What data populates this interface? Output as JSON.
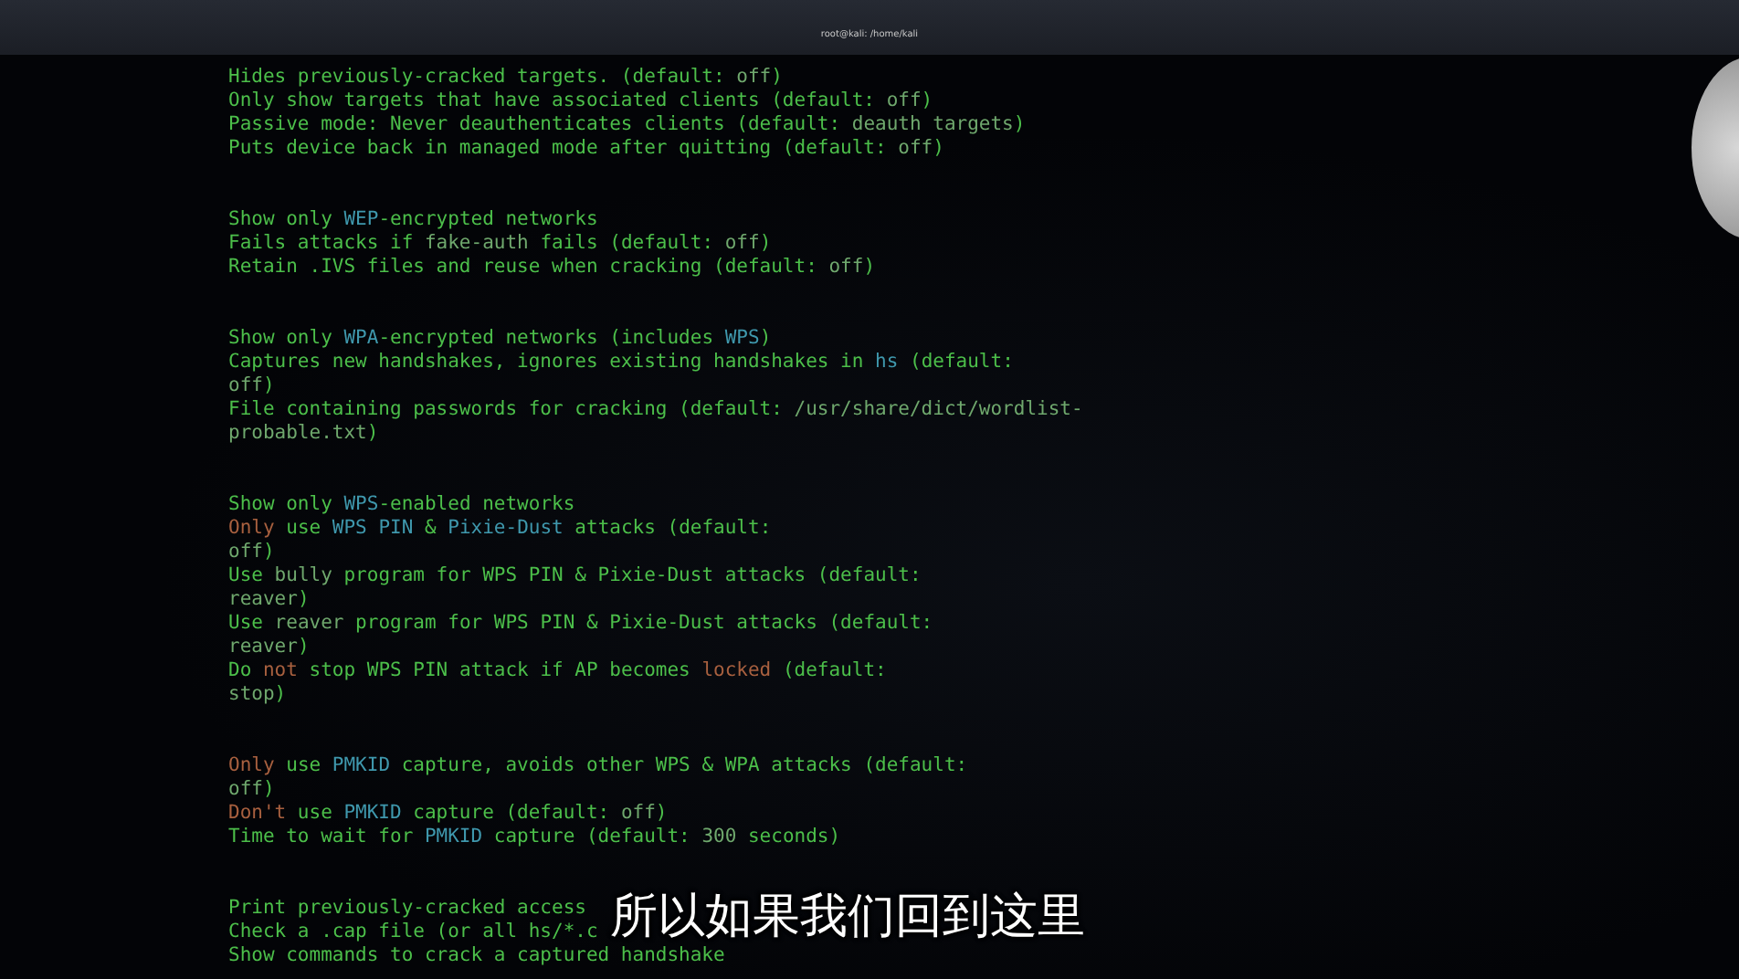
{
  "window": {
    "title": "root@kali: /home/kali"
  },
  "terminal": {
    "groups": [
      {
        "lines": [
          [
            {
              "kind": "plain",
              "text": "Hides previously-cracked targets. (default: "
            },
            {
              "kind": "value",
              "text": "off"
            },
            {
              "kind": "plain",
              "text": ")"
            }
          ],
          [
            {
              "kind": "plain",
              "text": "Only show targets that have associated clients (default: "
            },
            {
              "kind": "value",
              "text": "off"
            },
            {
              "kind": "plain",
              "text": ")"
            }
          ],
          [
            {
              "kind": "plain",
              "text": "Passive mode: Never deauthenticates clients (default: "
            },
            {
              "kind": "value",
              "text": "deauth targets"
            },
            {
              "kind": "plain",
              "text": ")"
            }
          ],
          [
            {
              "kind": "plain",
              "text": "Puts device back in managed mode after quitting (default: "
            },
            {
              "kind": "value",
              "text": "off"
            },
            {
              "kind": "plain",
              "text": ")"
            }
          ]
        ]
      },
      {
        "lines": [
          [
            {
              "kind": "plain",
              "text": "Show only "
            },
            {
              "kind": "key",
              "text": "WEP"
            },
            {
              "kind": "plain",
              "text": "-encrypted networks"
            }
          ],
          [
            {
              "kind": "plain",
              "text": "Fails attacks if "
            },
            {
              "kind": "value",
              "text": "fake-auth"
            },
            {
              "kind": "plain",
              "text": " fails (default: "
            },
            {
              "kind": "value",
              "text": "off"
            },
            {
              "kind": "plain",
              "text": ")"
            }
          ],
          [
            {
              "kind": "plain",
              "text": "Retain .IVS files and reuse when cracking (default: "
            },
            {
              "kind": "value",
              "text": "off"
            },
            {
              "kind": "plain",
              "text": ")"
            }
          ]
        ]
      },
      {
        "lines": [
          [
            {
              "kind": "plain",
              "text": "Show only "
            },
            {
              "kind": "key",
              "text": "WPA"
            },
            {
              "kind": "plain",
              "text": "-encrypted networks (includes "
            },
            {
              "kind": "key",
              "text": "WPS"
            },
            {
              "kind": "plain",
              "text": ")"
            }
          ],
          [
            {
              "kind": "plain",
              "text": "Captures new handshakes, ignores existing handshakes in "
            },
            {
              "kind": "key",
              "text": "hs"
            },
            {
              "kind": "plain",
              "text": " (default:"
            }
          ],
          [
            {
              "kind": "value",
              "text": "off"
            },
            {
              "kind": "plain",
              "text": ")"
            }
          ],
          [
            {
              "kind": "plain",
              "text": "File containing passwords for cracking (default: "
            },
            {
              "kind": "value",
              "text": "/usr/share/dict/wordlist-"
            }
          ],
          [
            {
              "kind": "value",
              "text": "probable.txt"
            },
            {
              "kind": "plain",
              "text": ")"
            }
          ]
        ]
      },
      {
        "lines": [
          [
            {
              "kind": "plain",
              "text": "Show only "
            },
            {
              "kind": "key",
              "text": "WPS"
            },
            {
              "kind": "plain",
              "text": "-enabled networks"
            }
          ],
          [
            {
              "kind": "neg",
              "text": "Only"
            },
            {
              "kind": "plain",
              "text": " use "
            },
            {
              "kind": "key",
              "text": "WPS PIN"
            },
            {
              "kind": "plain",
              "text": " & "
            },
            {
              "kind": "key",
              "text": "Pixie-Dust"
            },
            {
              "kind": "plain",
              "text": " attacks (default:"
            }
          ],
          [
            {
              "kind": "value",
              "text": "off"
            },
            {
              "kind": "plain",
              "text": ")"
            }
          ],
          [
            {
              "kind": "plain",
              "text": "Use "
            },
            {
              "kind": "value",
              "text": "bully"
            },
            {
              "kind": "plain",
              "text": " program for WPS PIN & Pixie-Dust attacks (default:"
            }
          ],
          [
            {
              "kind": "value",
              "text": "reaver"
            },
            {
              "kind": "plain",
              "text": ")"
            }
          ],
          [
            {
              "kind": "plain",
              "text": "Use "
            },
            {
              "kind": "value",
              "text": "reaver"
            },
            {
              "kind": "plain",
              "text": " program for WPS PIN & Pixie-Dust attacks (default:"
            }
          ],
          [
            {
              "kind": "value",
              "text": "reaver"
            },
            {
              "kind": "plain",
              "text": ")"
            }
          ],
          [
            {
              "kind": "plain",
              "text": "Do "
            },
            {
              "kind": "neg",
              "text": "not"
            },
            {
              "kind": "plain",
              "text": " stop WPS PIN attack if AP becomes "
            },
            {
              "kind": "neg",
              "text": "locked"
            },
            {
              "kind": "plain",
              "text": " (default:"
            }
          ],
          [
            {
              "kind": "value",
              "text": "stop"
            },
            {
              "kind": "plain",
              "text": ")"
            }
          ]
        ]
      },
      {
        "lines": [
          [
            {
              "kind": "neg",
              "text": "Only"
            },
            {
              "kind": "plain",
              "text": " use "
            },
            {
              "kind": "key",
              "text": "PMKID"
            },
            {
              "kind": "plain",
              "text": " capture, avoids other WPS & WPA attacks (default:"
            }
          ],
          [
            {
              "kind": "value",
              "text": "off"
            },
            {
              "kind": "plain",
              "text": ")"
            }
          ],
          [
            {
              "kind": "neg",
              "text": "Don't"
            },
            {
              "kind": "plain",
              "text": " use "
            },
            {
              "kind": "key",
              "text": "PMKID"
            },
            {
              "kind": "plain",
              "text": " capture (default: "
            },
            {
              "kind": "value",
              "text": "off"
            },
            {
              "kind": "plain",
              "text": ")"
            }
          ],
          [
            {
              "kind": "plain",
              "text": "Time to wait for "
            },
            {
              "kind": "key",
              "text": "PMKID"
            },
            {
              "kind": "plain",
              "text": " capture (default: "
            },
            {
              "kind": "value",
              "text": "300"
            },
            {
              "kind": "plain",
              "text": " seconds)"
            }
          ]
        ]
      },
      {
        "lines": [
          [
            {
              "kind": "plain",
              "text": "Print previously-cracked access"
            }
          ],
          [
            {
              "kind": "plain",
              "text": "Check a .cap file (or all hs/*.c"
            }
          ],
          [
            {
              "kind": "plain",
              "text": "Show commands to crack a captured handshake"
            }
          ]
        ]
      }
    ]
  },
  "subtitle": "所以如果我们回到这里"
}
